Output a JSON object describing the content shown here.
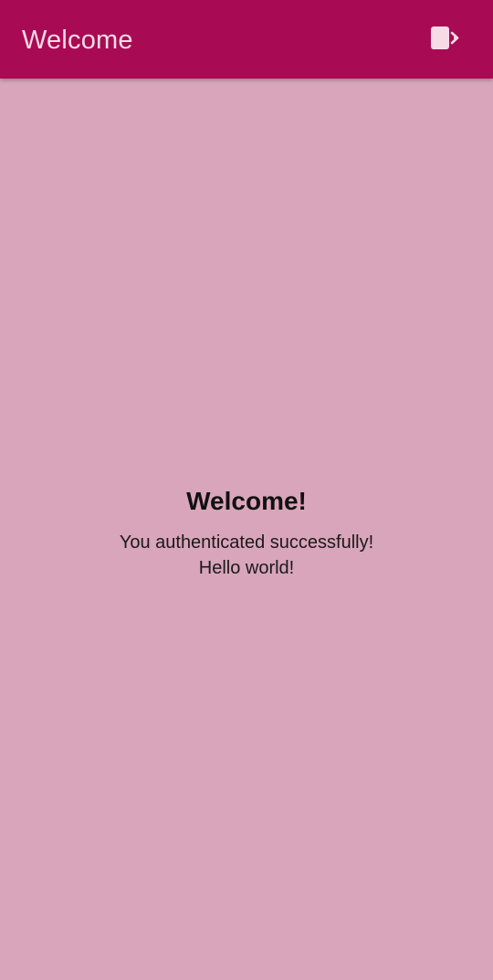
{
  "app_bar": {
    "title": "Welcome",
    "logout_icon": "logout-icon",
    "background_color": "#a90a54",
    "title_color": "#f6dbe6"
  },
  "main": {
    "heading": "Welcome!",
    "message_line1": "You authenticated successfully!",
    "message_line2": "Hello world!",
    "background_color": "#d9a5bb"
  }
}
